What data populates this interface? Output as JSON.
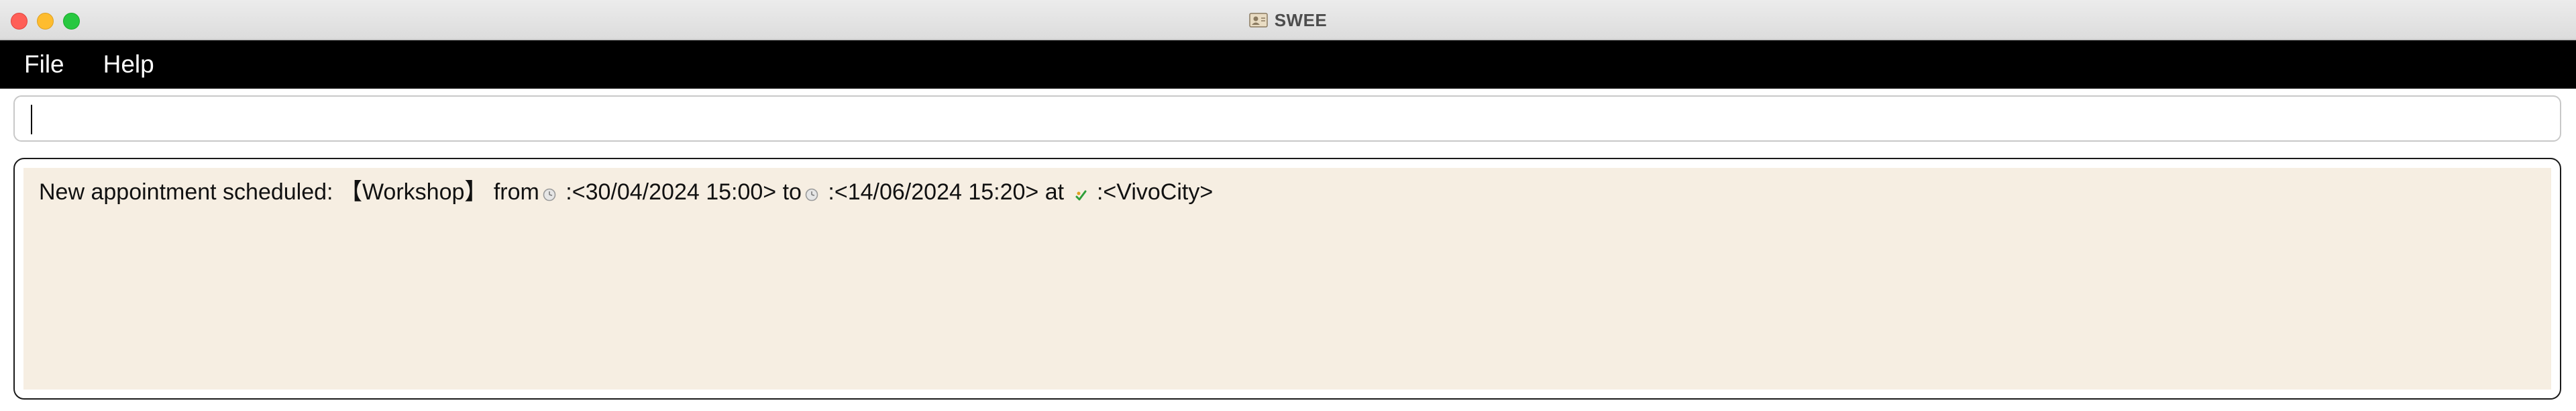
{
  "window": {
    "title": "SWEE",
    "title_icon": "person-card-icon"
  },
  "menubar": {
    "items": [
      {
        "label": "File"
      },
      {
        "label": "Help"
      }
    ]
  },
  "command": {
    "value": "",
    "placeholder": ""
  },
  "result": {
    "prefix": "New appointment scheduled: ",
    "event_name": "【Workshop】",
    "from_label": " from",
    "from_icon": "clock-icon",
    "from_value": " :<30/04/2024 15:00>",
    "to_label": " to",
    "to_icon": "clock-icon",
    "to_value": " :<14/06/2024 15:20>",
    "at_label": " at ",
    "at_icon": "location-pin-icon",
    "at_value": " :<VivoCity>"
  },
  "colors": {
    "menubar_bg": "#000000",
    "result_bg": "#f6eee2",
    "close": "#ff5f57",
    "minimize": "#febc2e",
    "zoom": "#28c840",
    "location_icon": "#2e9e3a"
  }
}
